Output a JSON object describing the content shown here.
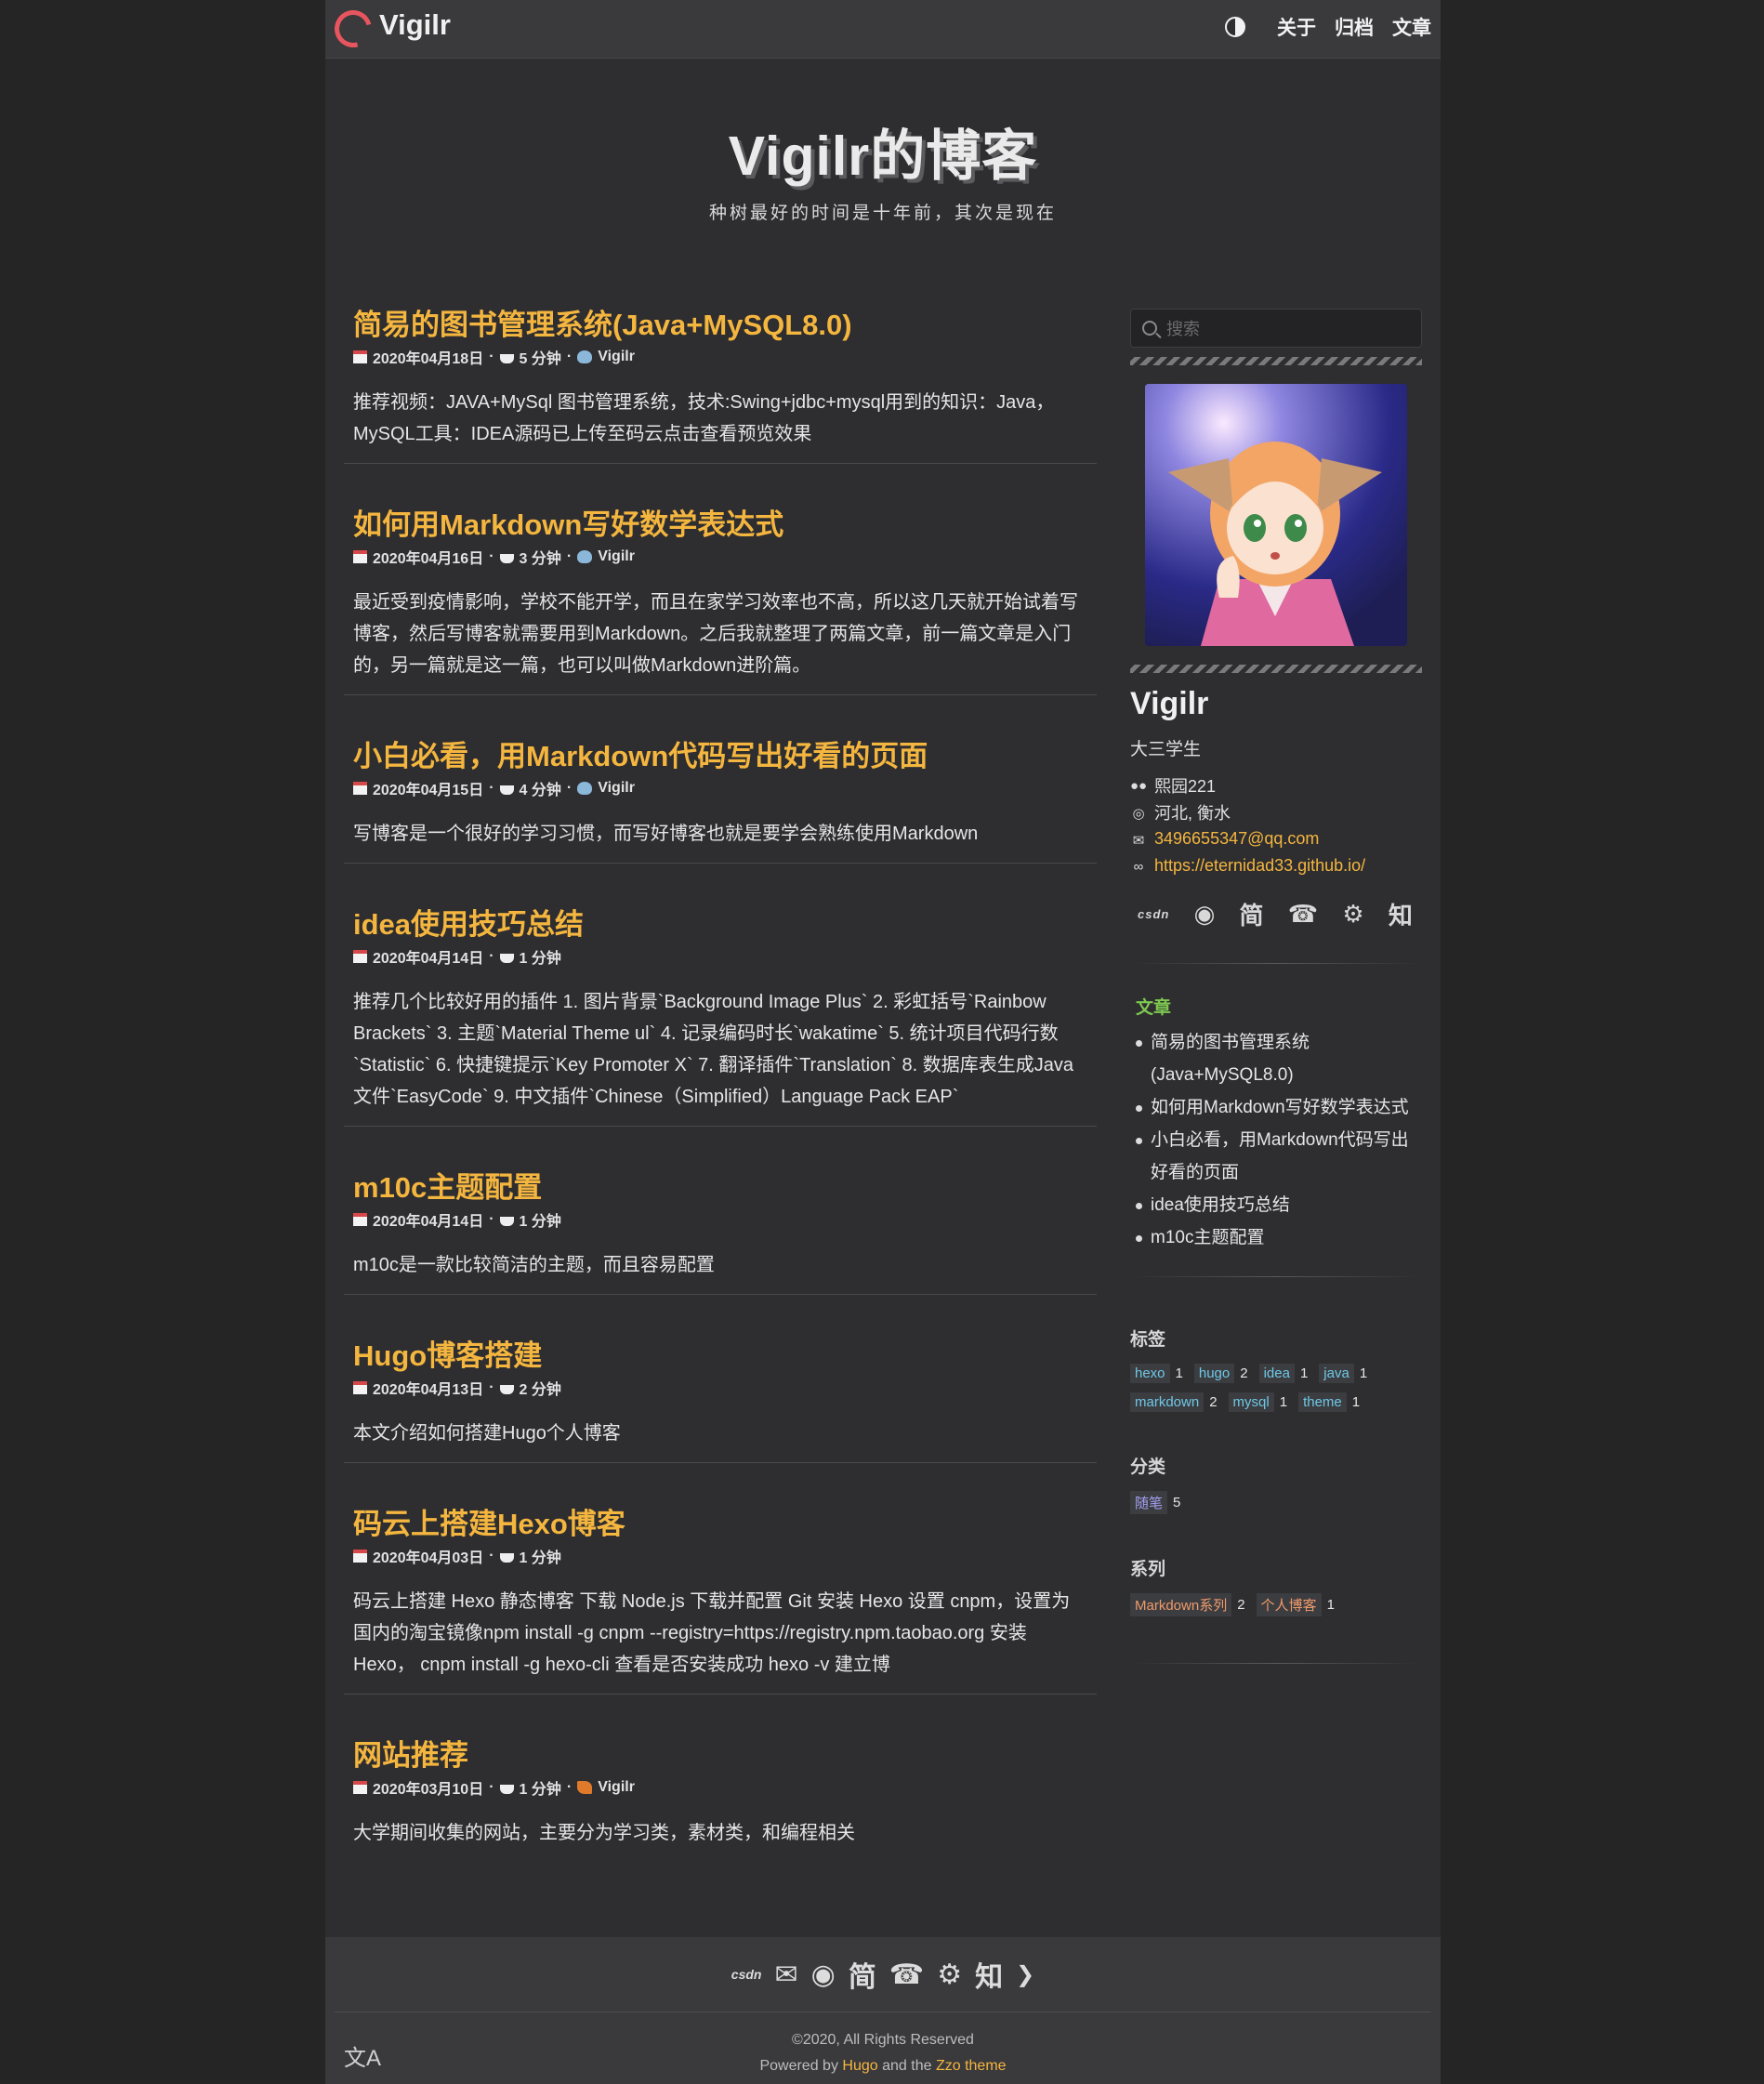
{
  "header": {
    "site_name": "Vigilr",
    "nav": [
      "关于",
      "归档",
      "文章"
    ]
  },
  "hero": {
    "title": "Vigilr的博客",
    "subtitle": "种树最好的时间是十年前，其次是现在"
  },
  "posts": [
    {
      "title": "简易的图书管理系统(Java+MySQL8.0)",
      "date": "2020年04月18日",
      "read": "5 分钟",
      "author": "Vigilr",
      "summary": "推荐视频：JAVA+MySql 图书管理系统，技术:Swing+jdbc+mysql用到的知识：Java，MySQL工具：IDEA源码已上传至码云点击查看预览效果"
    },
    {
      "title": "如何用Markdown写好数学表达式",
      "date": "2020年04月16日",
      "read": "3 分钟",
      "author": "Vigilr",
      "summary": "最近受到疫情影响，学校不能开学，而且在家学习效率也不高，所以这几天就开始试着写博客，然后写博客就需要用到Markdown。之后我就整理了两篇文章，前一篇文章是入门的，另一篇就是这一篇，也可以叫做Markdown进阶篇。"
    },
    {
      "title": "小白必看，用Markdown代码写出好看的页面",
      "date": "2020年04月15日",
      "read": "4 分钟",
      "author": "Vigilr",
      "summary": "写博客是一个很好的学习习惯，而写好博客也就是要学会熟练使用Markdown"
    },
    {
      "title": "idea使用技巧总结",
      "date": "2020年04月14日",
      "read": "1 分钟",
      "author": "",
      "summary": "推荐几个比较好用的插件 1. 图片背景`Background Image Plus` 2. 彩虹括号`Rainbow Brackets` 3. 主题`Material Theme ul` 4. 记录编码时长`wakatime` 5. 统计项目代码行数`Statistic` 6. 快捷键提示`Key Promoter X` 7. 翻译插件`Translation` 8. 数据库表生成Java文件`EasyCode` 9. 中文插件`Chinese（Simplified）Language Pack EAP`"
    },
    {
      "title": "m10c主题配置",
      "date": "2020年04月14日",
      "read": "1 分钟",
      "author": "",
      "summary": "m10c是一款比较简洁的主题，而且容易配置"
    },
    {
      "title": "Hugo博客搭建",
      "date": "2020年04月13日",
      "read": "2 分钟",
      "author": "",
      "summary": "本文介绍如何搭建Hugo个人博客"
    },
    {
      "title": "码云上搭建Hexo博客",
      "date": "2020年04月03日",
      "read": "1 分钟",
      "author": "",
      "summary": "码云上搭建 Hexo 静态博客 下载 Node.js 下载并配置 Git 安装 Hexo 设置 cnpm，设置为国内的淘宝镜像npm install -g cnpm --registry=https://registry.npm.taobao.org 安装 Hexo， cnpm install -g hexo-cli 查看是否安装成功 hexo -v 建立博"
    },
    {
      "title": "网站推荐",
      "date": "2020年03月10日",
      "read": "1 分钟",
      "author": "Vigilr",
      "summary": "大学期间收集的网站，主要分为学习类，素材类，和编程相关"
    }
  ],
  "sidebar": {
    "search_placeholder": "搜索",
    "author_name": "Vigilr",
    "bio": "大三学生",
    "org": "熙园221",
    "location": "河北, 衡水",
    "email": "3496655347@qq.com",
    "website": "https://eternidad33.github.io/",
    "social": [
      "csdn",
      "github",
      "简",
      "phone",
      "steam",
      "知"
    ],
    "recent_title": "文章",
    "recent": [
      "简易的图书管理系统(Java+MySQL8.0)",
      "如何用Markdown写好数学表达式",
      "小白必看，用Markdown代码写出好看的页面",
      "idea使用技巧总结",
      "m10c主题配置"
    ],
    "tags_title": "标签",
    "tags": [
      [
        "hexo",
        "1"
      ],
      [
        "hugo",
        "2"
      ],
      [
        "idea",
        "1"
      ],
      [
        "java",
        "1"
      ],
      [
        "markdown",
        "2"
      ],
      [
        "mysql",
        "1"
      ],
      [
        "theme",
        "1"
      ]
    ],
    "categories_title": "分类",
    "categories": [
      [
        "随笔",
        "5"
      ]
    ],
    "series_title": "系列",
    "series": [
      [
        "Markdown系列",
        "2"
      ],
      [
        "个人博客",
        "1"
      ]
    ]
  },
  "footer": {
    "copyright": "©2020, All Rights Reserved",
    "powered_pre": "Powered by",
    "hugo": "Hugo",
    "and_the": "and the",
    "theme": "Zzo theme"
  },
  "colors": {
    "accent": "#f4b63f",
    "background": "#2e2d30",
    "header": "#3a393c"
  }
}
